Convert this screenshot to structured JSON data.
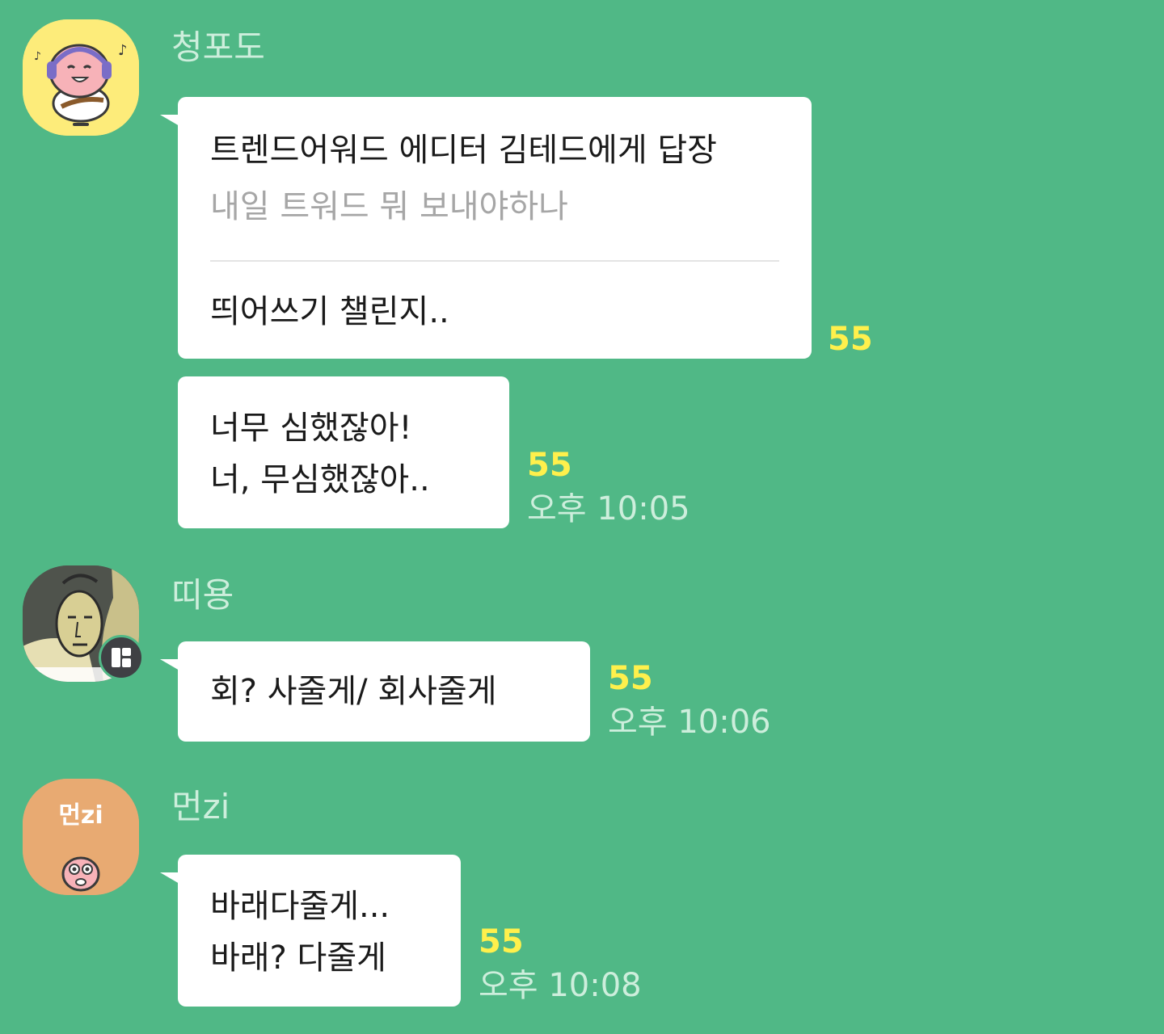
{
  "messages": [
    {
      "sender": "청포도",
      "quote_title": "트렌드어워드 에디터 김테드에게 답장",
      "quote_text": "내일 트워드 뭐 보내야하나",
      "text": "띄어쓰기 챌린지..",
      "unread": "55"
    },
    {
      "line1": "너무 심했잖아!",
      "line2": "너, 무심했잖아..",
      "unread": "55",
      "time": "오후 10:05"
    },
    {
      "sender": "띠용",
      "text": "회? 사줄게/ 회사줄게",
      "unread": "55",
      "time": "오후 10:06"
    },
    {
      "sender": "먼zi",
      "avatar_text": "먼zi",
      "line1": "바래다줄게...",
      "line2": "바래? 다줄게",
      "unread": "55",
      "time": "오후 10:08"
    }
  ]
}
